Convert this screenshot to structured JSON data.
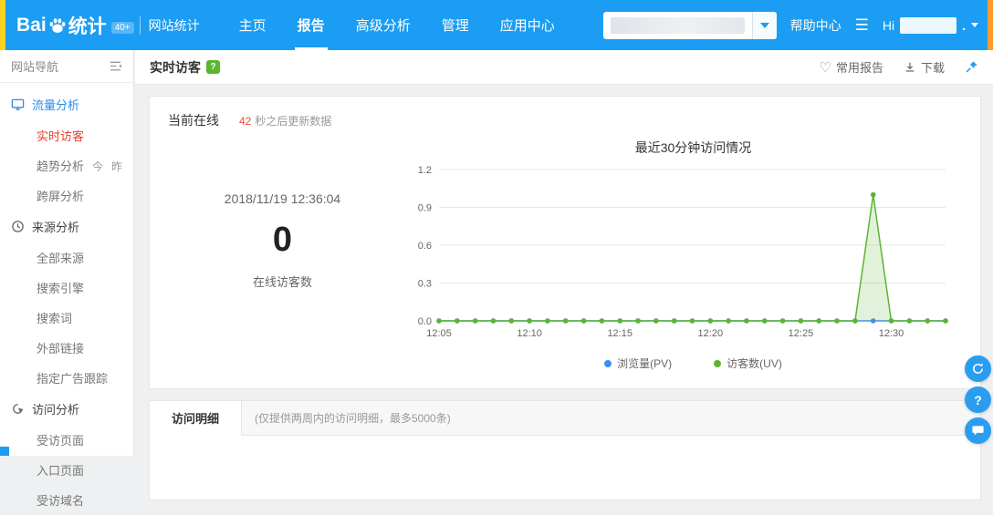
{
  "navbar": {
    "logo_prefix": "Bai",
    "logo_suffix": "统计",
    "version_badge": "40+",
    "product": "网站统计",
    "items": [
      {
        "label": "主页"
      },
      {
        "label": "报告"
      },
      {
        "label": "高级分析"
      },
      {
        "label": "管理"
      },
      {
        "label": "应用中心"
      }
    ],
    "help_label": "帮助中心",
    "burger_glyph": "☰",
    "greeting": "Hi",
    "user_suffix": "."
  },
  "sidebar": {
    "title": "网站导航",
    "sections": [
      {
        "label": "流量分析",
        "children": [
          {
            "label": "实时访客"
          },
          {
            "label": "趋势分析",
            "extras": [
              "今",
              "昨"
            ]
          },
          {
            "label": "跨屏分析"
          }
        ]
      },
      {
        "label": "来源分析",
        "children": [
          {
            "label": "全部来源"
          },
          {
            "label": "搜索引擎"
          },
          {
            "label": "搜索词"
          },
          {
            "label": "外部链接"
          },
          {
            "label": "指定广告跟踪"
          }
        ]
      },
      {
        "label": "访问分析",
        "children": [
          {
            "label": "受访页面"
          },
          {
            "label": "入口页面"
          },
          {
            "label": "受访域名"
          }
        ]
      }
    ]
  },
  "toolbar": {
    "title": "实时访客",
    "help_badge": "?",
    "fav_label": "常用报告",
    "download_label": "下载"
  },
  "panel": {
    "current_online_label": "当前在线",
    "countdown": "42",
    "countdown_suffix": "秒之后更新数据",
    "timestamp": "2018/11/19 12:36:04",
    "online_count": "0",
    "online_count_label": "在线访客数"
  },
  "chart_data": {
    "type": "line",
    "title": "最近30分钟访问情况",
    "x": [
      "12:05",
      "12:06",
      "12:07",
      "12:08",
      "12:09",
      "12:10",
      "12:11",
      "12:12",
      "12:13",
      "12:14",
      "12:15",
      "12:16",
      "12:17",
      "12:18",
      "12:19",
      "12:20",
      "12:21",
      "12:22",
      "12:23",
      "12:24",
      "12:25",
      "12:26",
      "12:27",
      "12:28",
      "12:29",
      "12:30",
      "12:31",
      "12:32",
      "12:33"
    ],
    "xticks": [
      "12:05",
      "12:10",
      "12:15",
      "12:20",
      "12:25",
      "12:30"
    ],
    "yticks": [
      "0.0",
      "0.3",
      "0.6",
      "0.9",
      "1.2"
    ],
    "ylim": [
      0,
      1.2
    ],
    "grid": true,
    "legend_position": "bottom",
    "series": [
      {
        "name": "浏览量(PV)",
        "color": "#3e8ef7",
        "fill": false,
        "values": [
          0,
          0,
          0,
          0,
          0,
          0,
          0,
          0,
          0,
          0,
          0,
          0,
          0,
          0,
          0,
          0,
          0,
          0,
          0,
          0,
          0,
          0,
          0,
          0,
          0,
          0,
          0,
          0,
          0
        ]
      },
      {
        "name": "访客数(UV)",
        "color": "#5cb531",
        "fill": true,
        "values": [
          0,
          0,
          0,
          0,
          0,
          0,
          0,
          0,
          0,
          0,
          0,
          0,
          0,
          0,
          0,
          0,
          0,
          0,
          0,
          0,
          0,
          0,
          0,
          0,
          1,
          0,
          0,
          0,
          0
        ]
      }
    ]
  },
  "detail": {
    "tab_label": "访问明细",
    "note": "(仅提供两周内的访问明细，最多5000条)"
  }
}
